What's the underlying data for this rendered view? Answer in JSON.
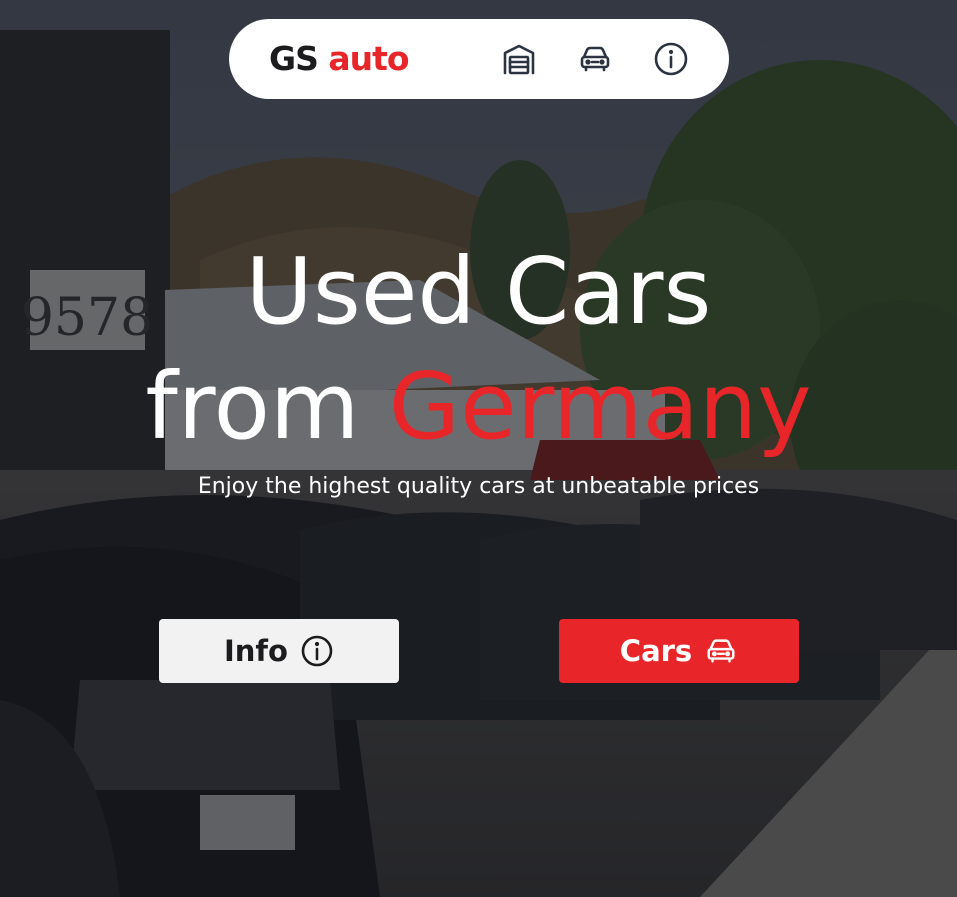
{
  "navbar": {
    "brand_prefix": "GS",
    "brand_suffix": "auto",
    "icons": [
      "garage-icon",
      "car-icon",
      "info-icon"
    ]
  },
  "hero": {
    "line1": "Used Cars",
    "line2_prefix": "from",
    "line2_accent": "Germany",
    "subtitle": "Enjoy the highest quality cars at unbeatable prices"
  },
  "buttons": {
    "info_label": "Info",
    "info_icon": "info-icon",
    "cars_label": "Cars",
    "cars_icon": "car-icon"
  },
  "colors": {
    "accent": "#e8262a",
    "navbar_bg": "#ffffff",
    "text_dark": "#1c1c1e",
    "info_button_bg": "#f2f2f2"
  }
}
